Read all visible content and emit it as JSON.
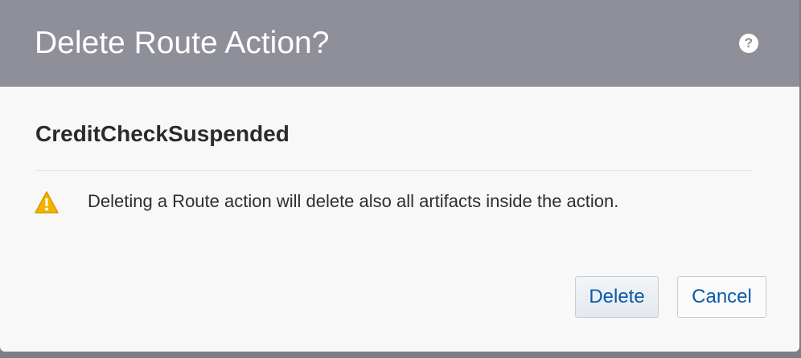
{
  "dialog": {
    "title": "Delete Route Action?",
    "help_label": "?",
    "subtitle": "CreditCheckSuspended",
    "message": "Deleting a Route action will delete also all artifacts inside the action.",
    "icons": {
      "help": "help-icon",
      "warning": "warning-icon"
    },
    "colors": {
      "header": "#8e8f99",
      "link": "#0a5aa6",
      "warning": "#f0b400"
    }
  },
  "buttons": {
    "delete_label": "Delete",
    "cancel_label": "Cancel"
  }
}
